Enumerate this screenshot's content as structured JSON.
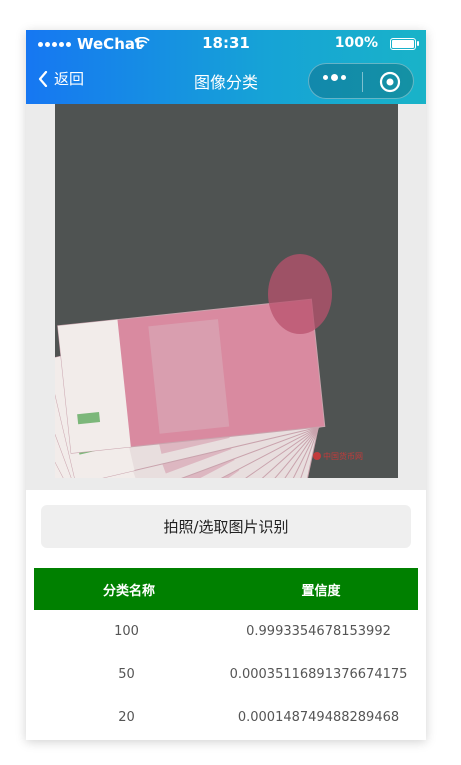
{
  "status_bar": {
    "carrier": "WeChat",
    "time": "18:31",
    "battery": "100%"
  },
  "nav": {
    "back_label": "返回",
    "title": "图像分类"
  },
  "action_button": "拍照/选取图片识别",
  "photo": {
    "description_icon": "banknote-fan-image",
    "watermark": "中国货币网"
  },
  "results_table": {
    "headers": [
      "分类名称",
      "置信度"
    ],
    "rows": [
      {
        "label": "100",
        "confidence": "0.9993354678153992"
      },
      {
        "label": "50",
        "confidence": "0.00035116891376674175"
      },
      {
        "label": "20",
        "confidence": "0.000148749488289468"
      }
    ]
  },
  "colors": {
    "header_gradient_start": "#1677f2",
    "header_gradient_end": "#19b3c8",
    "table_header": "#008000"
  }
}
